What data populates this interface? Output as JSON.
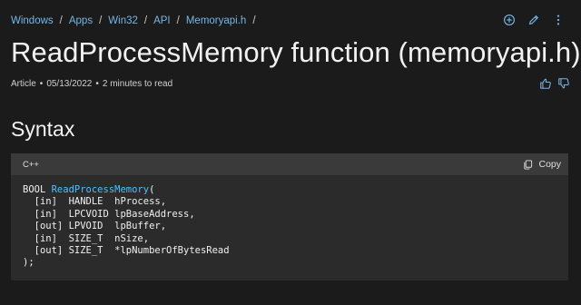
{
  "breadcrumb": {
    "items": [
      "Windows",
      "Apps",
      "Win32",
      "API",
      "Memoryapi.h"
    ],
    "separator": "/"
  },
  "top_actions": {
    "icons": [
      "add-collection-icon",
      "edit-icon",
      "more-options-icon"
    ]
  },
  "page": {
    "title": "ReadProcessMemory function (memoryapi.h)",
    "meta": {
      "type": "Article",
      "date": "05/13/2022",
      "read_time": "2 minutes to read",
      "separator": "•"
    }
  },
  "feedback": {
    "icons": [
      "thumbs-up-icon",
      "thumbs-down-icon"
    ]
  },
  "section": {
    "heading": "Syntax"
  },
  "code": {
    "language": "C++",
    "copy_label": "Copy",
    "return_type": "BOOL ",
    "function_name": "ReadProcessMemory",
    "open": "(",
    "params": [
      "  [in]  HANDLE  hProcess,",
      "  [in]  LPCVOID lpBaseAddress,",
      "  [out] LPVOID  lpBuffer,",
      "  [in]  SIZE_T  nSize,",
      "  [out] SIZE_T  *lpNumberOfBytesRead"
    ],
    "close": ");"
  },
  "colors": {
    "background": "#1b1b1b",
    "link": "#75b6e7",
    "code_background": "#2b2b2b",
    "code_header": "#3a3a3a",
    "function_highlight": "#4fc1ff"
  }
}
